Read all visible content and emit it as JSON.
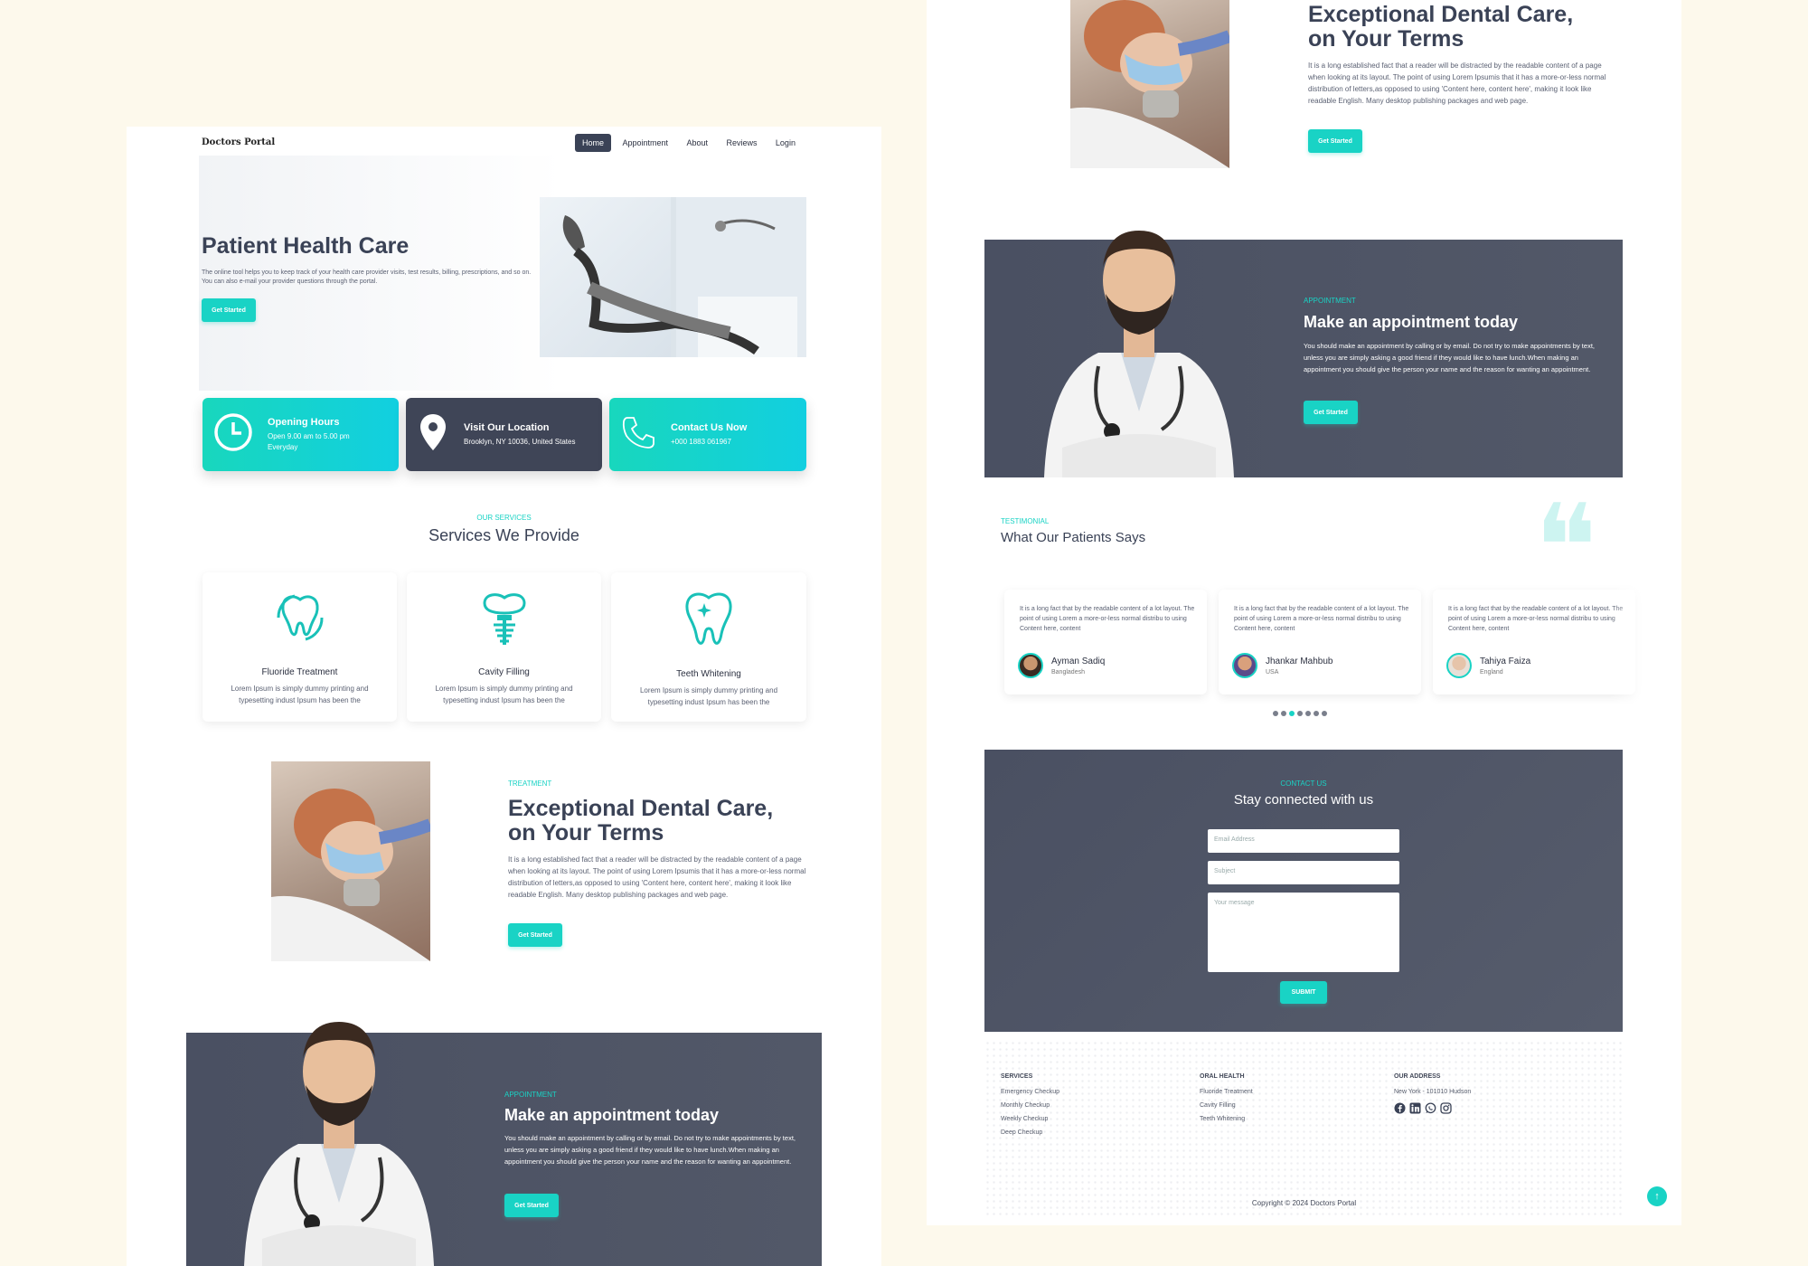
{
  "brand": "Doctors Portal",
  "nav": [
    "Home",
    "Appointment",
    "About",
    "Reviews",
    "Login"
  ],
  "hero": {
    "title": "Patient Health Care",
    "text": "The online tool helps you to keep track of your health care provider visits, test results, billing, prescriptions, and so on. You can also e-mail your provider questions through the portal.",
    "button": "Get Started"
  },
  "info_cards": [
    {
      "title": "Opening Hours",
      "line1": "Open 9.00 am to 5.00 pm",
      "line2": "Everyday",
      "icon": "clock-icon"
    },
    {
      "title": "Visit Our Location",
      "line1": "Brooklyn, NY 10036, United States",
      "line2": "",
      "icon": "location-pin-icon"
    },
    {
      "title": "Contact Us Now",
      "line1": "+000 1883 061967",
      "line2": "",
      "icon": "phone-icon"
    }
  ],
  "services": {
    "eyebrow": "OUR SERVICES",
    "title": "Services We Provide",
    "items": [
      {
        "name": "Fluoride Treatment",
        "text": "Lorem Ipsum is simply dummy printing and typesetting indust Ipsum has been the",
        "icon": "tooth-fluoride-icon"
      },
      {
        "name": "Cavity Filling",
        "text": "Lorem Ipsum is simply dummy printing and typesetting indust Ipsum has been the",
        "icon": "tooth-implant-icon"
      },
      {
        "name": "Teeth Whitening",
        "text": "Lorem Ipsum is simply dummy printing and typesetting indust Ipsum has been the",
        "icon": "tooth-sparkle-icon"
      }
    ]
  },
  "treatment": {
    "eyebrow": "TREATMENT",
    "title_line1": "Exceptional Dental Care,",
    "title_line2": "on Your Terms",
    "text": "It is a long established fact that a reader will be distracted by the readable content of a page when looking at its layout. The point of using Lorem Ipsumis that it has a more-or-less normal distribution of letters,as opposed to using 'Content here, content here', making it look like readable English. Many desktop publishing packages and web page.",
    "button": "Get Started"
  },
  "appointment": {
    "eyebrow": "APPOINTMENT",
    "title": "Make an appointment today",
    "text": "You should make an appointment by calling or by email. Do not try to make appointments by text, unless you are simply asking a good friend if they would like to have lunch.When making an appointment you should give the person your name and the reason for wanting an appointment.",
    "button": "Get Started"
  },
  "testimonial": {
    "eyebrow": "TESTIMONIAL",
    "title": "What Our Patients Says",
    "quote": "It is a long fact that by the readable content of a lot layout. The point of using Lorem a more-or-less normal distribu to using Content here, content",
    "items": [
      {
        "name": "Ayman Sadiq",
        "country": "Bangladesh"
      },
      {
        "name": "Jhankar Mahbub",
        "country": "USA"
      },
      {
        "name": "Tahiya Faiza",
        "country": "England"
      }
    ],
    "dots": 7,
    "active_dot": 2
  },
  "contact": {
    "eyebrow": "CONTACT US",
    "title": "Stay connected with us",
    "email_placeholder": "Email Address",
    "subject_placeholder": "Subject",
    "message_placeholder": "Your message",
    "submit": "SUBMIT"
  },
  "footer": {
    "services_title": "SERVICES",
    "services": [
      "Emergency Checkup",
      "Monthly Checkup",
      "Weekly Checkup",
      "Deep Checkup"
    ],
    "oral_title": "ORAL HEALTH",
    "oral": [
      "Fluoride Treatment",
      "Cavity Filling",
      "Teeth Whitening"
    ],
    "address_title": "OUR ADDRESS",
    "address": "New York - 101010 Hudson",
    "social": [
      "facebook-icon",
      "linkedin-icon",
      "whatsapp-icon",
      "instagram-icon"
    ],
    "copyright": "Copyright © 2024 Doctors Portal"
  },
  "colors": {
    "accent": "#19d3c5",
    "dark": "#4a5062",
    "background": "#fdf9ec"
  }
}
